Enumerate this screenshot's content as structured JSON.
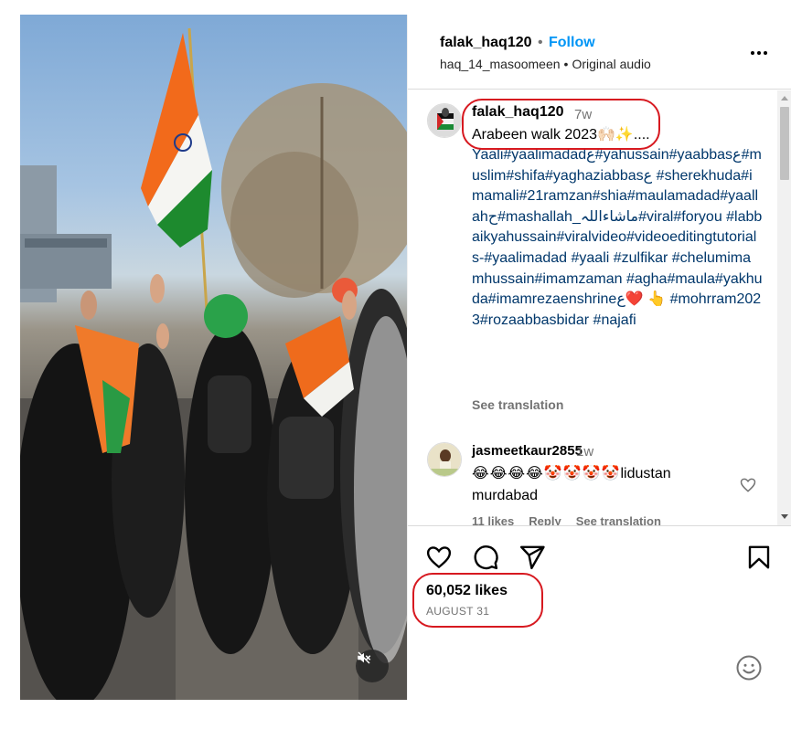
{
  "post": {
    "username": "falak_haq120",
    "separator": "•",
    "follow_label": "Follow",
    "audio_user": "haq_14_masoomeen",
    "audio_sep": "•",
    "audio_label": "Original audio"
  },
  "caption": {
    "username": "falak_haq120",
    "time": "7w",
    "title": "Arabeen walk 2023🙌🏻✨....",
    "body": "Yaali#yaalimadadع#yahussain#yaabbasع#muslim#shifa#yaghaziabbasع #sherekhuda#imamali#21ramzan#shia#maulamadad#yaallahح#mashallah_ماشاءاللہ#viral#foryou #labbaikyahussain#viralvideo#videoeditingtutorials-#yaalimadad #yaali #zulfikar #chelumimamhussain#imamzaman #agha#maula#yakhuda#imamrezaenshrineع❤️ 👆 #mohrram2023#rozaabbasbidar #najafi",
    "see_translation": "See translation"
  },
  "comment": {
    "username": "jasmeetkaur2855",
    "time": "1w",
    "emojis": "😂😂😂😂🤡🤡🤡🤡",
    "text": "lidustan murdabad",
    "likes": "11 likes",
    "reply": "Reply",
    "see_translation": "See translation"
  },
  "actions": {
    "likes_text": "60,052 likes",
    "date_text": "AUGUST 31"
  },
  "icons": {
    "more": "more-options-icon",
    "like": "heart-icon",
    "comment": "comment-icon",
    "share": "share-icon",
    "save": "bookmark-icon",
    "mute": "muted-speaker-icon",
    "emoji": "emoji-icon"
  },
  "colors": {
    "link": "#00376b",
    "follow": "#0095f6",
    "annotation": "#d71920"
  }
}
